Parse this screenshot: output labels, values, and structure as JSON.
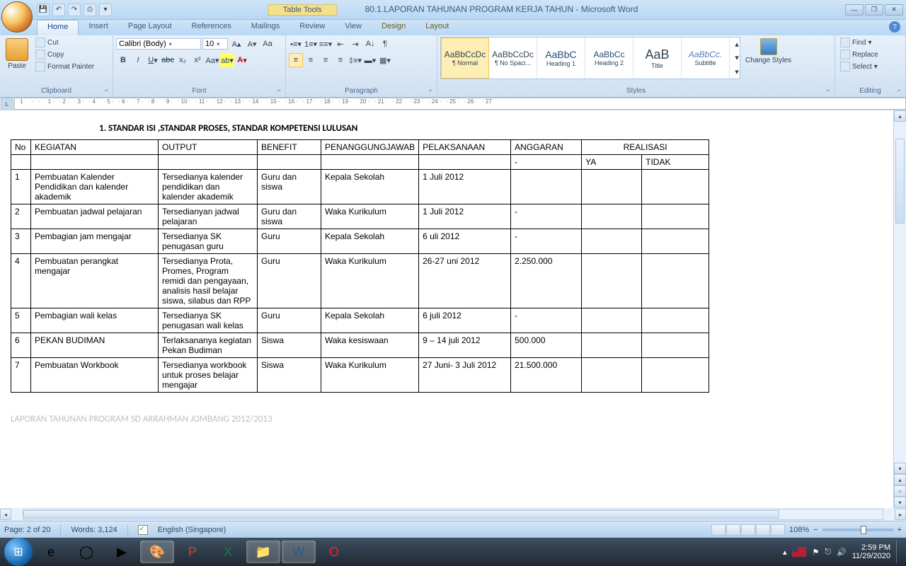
{
  "title": {
    "tableTools": "Table Tools",
    "docTitle": "80.1.LAPORAN TAHUNAN PROGRAM KERJA TAHUN - Microsoft Word"
  },
  "tabs": [
    "Home",
    "Insert",
    "Page Layout",
    "References",
    "Mailings",
    "Review",
    "View",
    "Design",
    "Layout"
  ],
  "ribbon": {
    "clipboard": {
      "paste": "Paste",
      "cut": "Cut",
      "copy": "Copy",
      "fp": "Format Painter",
      "label": "Clipboard"
    },
    "font": {
      "name": "Calibri (Body)",
      "size": "10",
      "label": "Font"
    },
    "paragraph": {
      "label": "Paragraph"
    },
    "styles": {
      "items": [
        {
          "prev": "AaBbCcDc",
          "name": "¶ Normal"
        },
        {
          "prev": "AaBbCcDc",
          "name": "¶ No Spaci..."
        },
        {
          "prev": "AaBbC",
          "name": "Heading 1"
        },
        {
          "prev": "AaBbCc",
          "name": "Heading 2"
        },
        {
          "prev": "AaB",
          "name": "Title"
        },
        {
          "prev": "AaBbCc.",
          "name": "Subtitle"
        }
      ],
      "change": "Change Styles",
      "label": "Styles"
    },
    "editing": {
      "find": "Find",
      "replace": "Replace",
      "select": "Select",
      "label": "Editing"
    }
  },
  "document": {
    "heading": "1.     STANDAR ISI ,STANDAR PROSES, STANDAR KOMPETENSI  LULUSAN",
    "headers": [
      "No",
      "KEGIATAN",
      "OUTPUT",
      "BENEFIT",
      "PENANGGUNGJAWAB",
      "PELAKSANAAN",
      "ANGGARAN",
      "REALISASI"
    ],
    "subheaders": {
      "anggaran": "-",
      "ya": "YA",
      "tidak": "TIDAK"
    },
    "rows": [
      {
        "no": "1",
        "kegiatan": "Pembuatan Kalender Pendidikan dan kalender akademik",
        "output": "Tersedianya kalender pendidikan dan kalender akademik",
        "benefit": "Guru dan siswa",
        "pj": "Kepala Sekolah",
        "pel": "1 Juli 2012",
        "ang": "",
        "ya": "",
        "tidak": ""
      },
      {
        "no": "2",
        "kegiatan": "Pembuatan jadwal pelajaran",
        "output": "Tersedianyan jadwal pelajaran",
        "benefit": "Guru dan siswa",
        "pj": "Waka Kurikulum",
        "pel": "1 Juli 2012",
        "ang": "-",
        "ya": "",
        "tidak": ""
      },
      {
        "no": "3",
        "kegiatan": "Pembagian jam mengajar",
        "output": "Tersedianya SK penugasan guru",
        "benefit": "Guru",
        "pj": "Kepala Sekolah",
        "pel": "6 uli 2012",
        "ang": "-",
        "ya": "",
        "tidak": ""
      },
      {
        "no": "4",
        "kegiatan": "Pembuatan perangkat mengajar",
        "output": "Tersedianya Prota, Promes, Program remidi dan pengayaan, analisis hasil belajar siswa, silabus dan RPP",
        "benefit": "Guru",
        "pj": "Waka Kurikulum",
        "pel": "26-27 uni 2012",
        "ang": "2.250.000",
        "ya": "",
        "tidak": ""
      },
      {
        "no": "5",
        "kegiatan": "Pembagian wali kelas",
        "output": "Tersedianya SK penugasan wali kelas",
        "benefit": "Guru",
        "pj": "Kepala Sekolah",
        "pel": "6 juli 2012",
        "ang": "-",
        "ya": "",
        "tidak": ""
      },
      {
        "no": "6",
        "kegiatan": "PEKAN BUDIMAN",
        "output": "Terlaksananya kegiatan Pekan Budiman",
        "benefit": "Siswa",
        "pj": "Waka kesiswaan",
        "pel": "9 – 14 juli 2012",
        "ang": "500.000",
        "ya": "",
        "tidak": ""
      },
      {
        "no": "7",
        "kegiatan": "Pembuatan Workbook",
        "output": "Tersedianya workbook untuk proses belajar mengajar",
        "benefit": "Siswa",
        "pj": "Waka Kurikulum",
        "pel": "27 Juni- 3 Juli 2012",
        "ang": "21.500.000",
        "ya": "",
        "tidak": ""
      }
    ],
    "footer": "LAPORAN TAHUNAN PROGRAM SD ARRAHMAN JOMBANG 2012/2013"
  },
  "status": {
    "page": "Page: 2 of 20",
    "words": "Words: 3,124",
    "lang": "English (Singapore)",
    "zoom": "108%"
  },
  "taskbar": {
    "time": "2:59 PM",
    "date": "11/29/2020"
  }
}
